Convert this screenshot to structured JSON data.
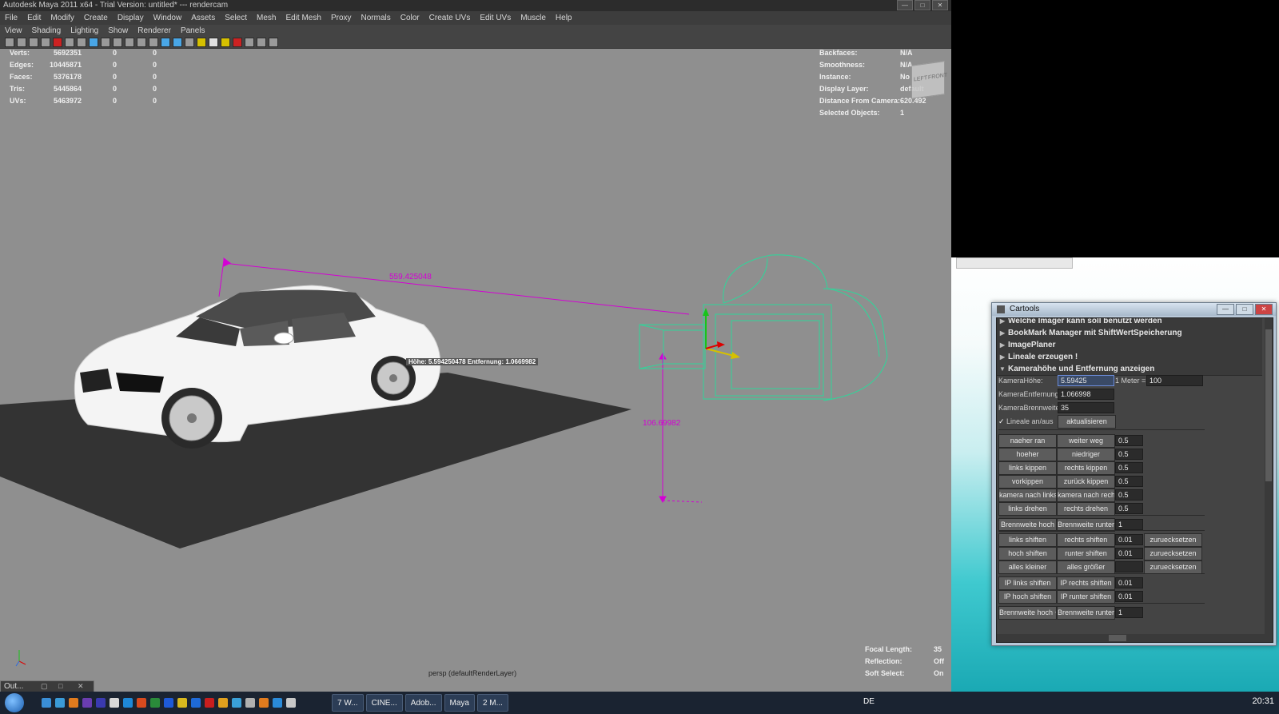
{
  "window": {
    "title": "Autodesk Maya 2011 x64 - Trial Version: untitled*   ---   rendercam",
    "controls": [
      "—",
      "□",
      "✕"
    ]
  },
  "menubar": [
    "File",
    "Edit",
    "Modify",
    "Create",
    "Display",
    "Window",
    "Assets",
    "Select",
    "Mesh",
    "Edit Mesh",
    "Proxy",
    "Normals",
    "Color",
    "Create UVs",
    "Edit UVs",
    "Muscle",
    "Help"
  ],
  "panel_menu": [
    "View",
    "Shading",
    "Lighting",
    "Show",
    "Renderer",
    "Panels"
  ],
  "hud_left": [
    {
      "label": "Verts:",
      "v1": "5692351",
      "v2": "0",
      "v3": "0"
    },
    {
      "label": "Edges:",
      "v1": "10445871",
      "v2": "0",
      "v3": "0"
    },
    {
      "label": "Faces:",
      "v1": "5376178",
      "v2": "0",
      "v3": "0"
    },
    {
      "label": "Tris:",
      "v1": "5445864",
      "v2": "0",
      "v3": "0"
    },
    {
      "label": "UVs:",
      "v1": "5463972",
      "v2": "0",
      "v3": "0"
    }
  ],
  "hud_right": [
    {
      "label": "Backfaces:",
      "value": "N/A"
    },
    {
      "label": "Smoothness:",
      "value": "N/A"
    },
    {
      "label": "Instance:",
      "value": "No"
    },
    {
      "label": "Display Layer:",
      "value": "default"
    },
    {
      "label": "Distance From Camera:",
      "value": "620.492"
    },
    {
      "label": "Selected Objects:",
      "value": "1"
    }
  ],
  "hud_bottom_right": [
    {
      "label": "Focal Length:",
      "value": "35"
    },
    {
      "label": "Reflection:",
      "value": "Off"
    },
    {
      "label": "Soft Select:",
      "value": "On"
    }
  ],
  "viewport": {
    "dimension_distance": "559.425048",
    "dimension_height": "106.69982",
    "overlay_label": "Höhe: 5.594250478  Entfernung: 1.0669982",
    "camera_label": "persp (defaultRenderLayer)",
    "viewcube_left": "LEFT",
    "viewcube_front": "FRONT"
  },
  "outliner_tab": {
    "label": "Out..."
  },
  "cartools": {
    "title": "Cartools",
    "sections": [
      {
        "label": "Welche Imager kann soll benutzt werden",
        "expanded": false
      },
      {
        "label": "BookMark Manager mit ShiftWertSpeicherung",
        "expanded": false
      },
      {
        "label": "ImagePlaner",
        "expanded": false
      },
      {
        "label": "Lineale erzeugen !",
        "expanded": false
      },
      {
        "label": "Kamerahöhe und Entfernung anzeigen",
        "expanded": true
      }
    ],
    "fields": {
      "kamera_hoehe_label": "KameraHöhe:",
      "kamera_hoehe_value": "5.59425",
      "meter_label": "1 Meter =",
      "meter_value": "100",
      "kamera_entfernung_label": "KameraEntfernung:",
      "kamera_entfernung_value": "1.066998",
      "kamera_brennweite_label": "KameraBrennweite:",
      "kamera_brennweite_value": "35",
      "lineale_label": "Lineale an/aus",
      "aktualisieren": "aktualisieren"
    },
    "button_rows": [
      {
        "b1": "naeher ran",
        "b2": "weiter weg",
        "v": "0.5",
        "b3": ""
      },
      {
        "b1": "hoeher",
        "b2": "niedriger",
        "v": "0.5",
        "b3": ""
      },
      {
        "b1": "links kippen",
        "b2": "rechts kippen",
        "v": "0.5",
        "b3": ""
      },
      {
        "b1": "vorkippen",
        "b2": "zurück kippen",
        "v": "0.5",
        "b3": ""
      },
      {
        "b1": "kamera nach links",
        "b2": "kamera nach rechts",
        "v": "0.5",
        "b3": ""
      },
      {
        "b1": "links drehen",
        "b2": "rechts drehen",
        "v": "0.5",
        "b3": ""
      },
      {
        "b1": "Brennweite hoch",
        "b2": "Brennweite runter",
        "v": "1",
        "b3": ""
      },
      {
        "b1": "links shiften",
        "b2": "rechts shiften",
        "v": "0.01",
        "b3": "zuruecksetzen"
      },
      {
        "b1": "hoch shiften",
        "b2": "runter shiften",
        "v": "0.01",
        "b3": "zuruecksetzen"
      },
      {
        "b1": "alles kleiner",
        "b2": "alles größer",
        "v": "",
        "b3": "zuruecksetzen"
      },
      {
        "b1": "IP links shiften",
        "b2": "IP rechts shiften",
        "v": "0.01",
        "b3": ""
      },
      {
        "b1": "IP hoch shiften",
        "b2": "IP runter shiften",
        "v": "0.01",
        "b3": ""
      },
      {
        "b1": "Brennweite hoch +",
        "b2": "Brennweite runter +",
        "v": "1",
        "b3": ""
      }
    ]
  },
  "taskbar": {
    "tasks": [
      "7 W...",
      "CINE...",
      "Adob...",
      "Maya",
      "2 M..."
    ],
    "language": "DE",
    "clock": "20:31"
  },
  "colors": {
    "viewport_bg": "#8f8f8f",
    "ground": "#333333",
    "dimension": "#d400d4",
    "camera_wire": "#2fd69a"
  }
}
